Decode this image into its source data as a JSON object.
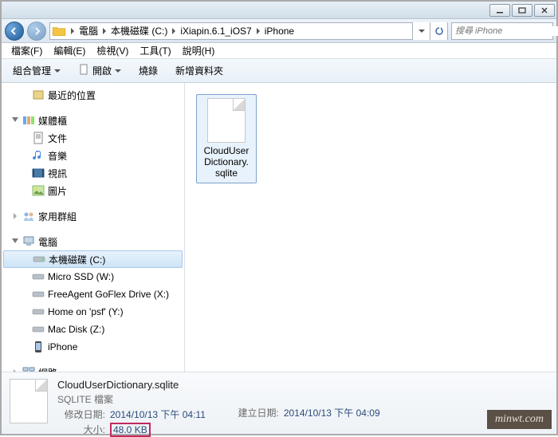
{
  "window": {
    "title": ""
  },
  "breadcrumbs": [
    "電腦",
    "本機磁碟 (C:)",
    "iXiapin.6.1_iOS7",
    "iPhone"
  ],
  "search": {
    "placeholder": "搜尋 iPhone"
  },
  "menus": [
    "檔案(F)",
    "編輯(E)",
    "檢視(V)",
    "工具(T)",
    "說明(H)"
  ],
  "toolbar": {
    "organize": "組合管理",
    "open": "開啟",
    "burn": "燒錄",
    "newfolder": "新增資料夾"
  },
  "sidebar": {
    "recent": "最近的位置",
    "libraries": "媒體櫃",
    "lib_docs": "文件",
    "lib_music": "音樂",
    "lib_video": "視訊",
    "lib_pic": "圖片",
    "homegroup": "家用群組",
    "computer": "電腦",
    "drive_c": "本機磁碟 (C:)",
    "drive_w": "Micro SSD (W:)",
    "drive_x": "FreeAgent GoFlex Drive (X:)",
    "drive_y": "Home on 'psf' (Y:)",
    "drive_z": "Mac Disk (Z:)",
    "iphone": "iPhone",
    "network": "網路"
  },
  "file": {
    "label_line1": "CloudUser",
    "label_line2": "Dictionary.",
    "label_line3": "sqlite"
  },
  "details": {
    "name": "CloudUserDictionary.sqlite",
    "type": "SQLITE 檔案",
    "created_label": "建立日期:",
    "created_value": "2014/10/13 下午 04:09",
    "modified_label": "修改日期:",
    "modified_value": "2014/10/13 下午 04:11",
    "size_label": "大小:",
    "size_value": "48.0 KB"
  },
  "watermark": "minwt.com"
}
